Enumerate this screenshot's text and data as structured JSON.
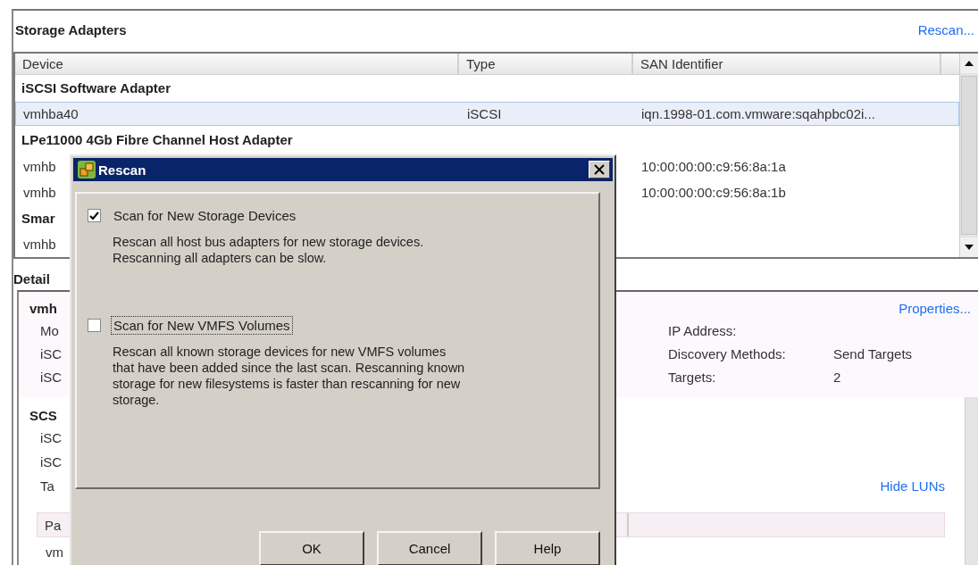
{
  "storage_adapters": {
    "title": "Storage Adapters",
    "rescan_link": "Rescan...",
    "table": {
      "columns": [
        "Device",
        "Type",
        "SAN Identifier"
      ],
      "rows": [
        {
          "kind": "group",
          "device": "iSCSI Software Adapter",
          "selected": false
        },
        {
          "kind": "item",
          "device": "vmhba40",
          "type": "iSCSI",
          "san_identifier": "iqn.1998-01.com.vmware:sqahpbc02i...",
          "selected": true
        },
        {
          "kind": "group",
          "device": "LPe11000 4Gb Fibre Channel Host Adapter",
          "selected": false
        },
        {
          "kind": "item",
          "device": "vmhb",
          "san_identifier": "10:00:00:00:c9:56:8a:1a",
          "selected": false
        },
        {
          "kind": "item",
          "device": "vmhb",
          "san_identifier": "10:00:00:00:c9:56:8a:1b",
          "selected": false
        },
        {
          "kind": "group",
          "device": "Smar",
          "selected": false
        },
        {
          "kind": "item",
          "device": "vmhb",
          "selected": false
        }
      ]
    }
  },
  "details": {
    "title": "Detail",
    "properties_link": "Properties...",
    "general": {
      "title": "vmh",
      "fields": [
        "Mo",
        "iSC",
        "iSC"
      ],
      "right_fields": [
        {
          "label": "IP Address:"
        },
        {
          "label": "Discovery Methods:",
          "value": "Send Targets"
        },
        {
          "label": "Targets:",
          "value": "2"
        }
      ]
    },
    "scsi": {
      "title": "SCS",
      "fields": [
        "iSC",
        "iSC",
        "Ta"
      ]
    },
    "hide_luns_link": "Hide LUNs",
    "paths_table": {
      "columns": [
        "Pa"
      ],
      "rows": [
        "vm"
      ]
    }
  },
  "dialog": {
    "title": "Rescan",
    "options": [
      {
        "label": "Scan for New Storage Devices",
        "checked": true,
        "focused": false,
        "description": "Rescan all host bus adapters for new storage devices.\nRescanning all adapters can be slow."
      },
      {
        "label": "Scan for New VMFS Volumes",
        "checked": false,
        "focused": true,
        "description": "Rescan all known storage devices for new VMFS  volumes\nthat have been added since the last scan. Rescanning known\nstorage for new filesystems is faster than rescanning for new\nstorage."
      }
    ],
    "buttons": [
      "OK",
      "Cancel",
      "Help"
    ]
  }
}
